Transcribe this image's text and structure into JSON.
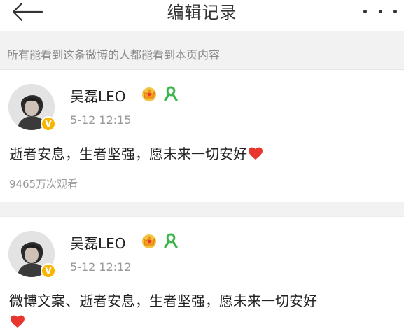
{
  "header": {
    "title": "编辑记录",
    "back_icon": "back-arrow-icon",
    "more_icon": "more-dots-icon"
  },
  "notice": {
    "text": "所有能看到这条微博的人都能看到本页内容"
  },
  "posts": [
    {
      "username": "吴磊LEO",
      "time": "5-12 12:15",
      "text": "逝者安息，生者坚强，愿未来一切安好",
      "views": "9465万次观看",
      "badges": [
        "crown-vip-icon",
        "green-ribbon-icon"
      ],
      "verified": "V"
    },
    {
      "username": "吴磊LEO",
      "time": "5-12 12:12",
      "text": "微博文案、逝者安息，生者坚强，愿未来一切安好",
      "badges": [
        "crown-vip-icon",
        "green-ribbon-icon"
      ],
      "verified": "V"
    }
  ],
  "colors": {
    "notice_bg": "#f2f2f2",
    "heart": "#e8362e",
    "verified": "#f7b500",
    "ribbon": "#3ab54a"
  }
}
